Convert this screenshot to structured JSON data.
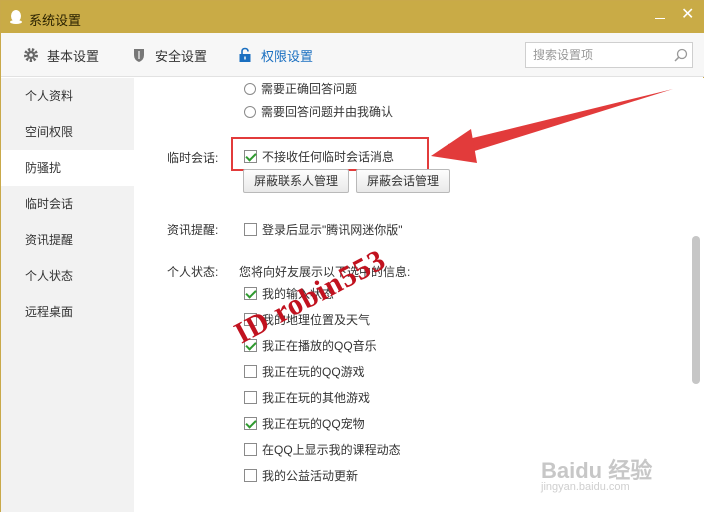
{
  "window": {
    "title": "系统设置"
  },
  "toolbar": {
    "tabs": [
      {
        "label": "基本设置",
        "icon": "gear-icon"
      },
      {
        "label": "安全设置",
        "icon": "shield-icon"
      },
      {
        "label": "权限设置",
        "icon": "lock-icon",
        "active": true
      }
    ],
    "search_placeholder": "搜索设置项"
  },
  "sidebar": {
    "items": [
      {
        "label": "个人资料"
      },
      {
        "label": "空间权限"
      },
      {
        "label": "防骚扰",
        "active": true
      },
      {
        "label": "临时会话"
      },
      {
        "label": "资讯提醒"
      },
      {
        "label": "个人状态"
      },
      {
        "label": "远程桌面"
      }
    ]
  },
  "content": {
    "verify_options": [
      {
        "label": "需要正确回答问题",
        "selected": false
      },
      {
        "label": "需要回答问题并由我确认",
        "selected": false
      }
    ],
    "temp_session": {
      "section_label": "临时会话:",
      "checkbox_label": "不接收任何临时会话消息",
      "checked": true,
      "buttons": [
        "屏蔽联系人管理",
        "屏蔽会话管理"
      ]
    },
    "news": {
      "section_label": "资讯提醒:",
      "checkbox_label": "登录后显示\"腾讯网迷你版\"",
      "checked": false
    },
    "status": {
      "section_label": "个人状态:",
      "intro": "您将向好友展示以下选中的信息:",
      "items": [
        {
          "label": "我的输入状态",
          "checked": true
        },
        {
          "label": "我的地理位置及天气",
          "checked": false
        },
        {
          "label": "我正在播放的QQ音乐",
          "checked": true
        },
        {
          "label": "我正在玩的QQ游戏",
          "checked": false
        },
        {
          "label": "我正在玩的其他游戏",
          "checked": false
        },
        {
          "label": "我正在玩的QQ宠物",
          "checked": true
        },
        {
          "label": "在QQ上显示我的课程动态",
          "checked": false
        },
        {
          "label": "我的公益活动更新",
          "checked": false
        }
      ]
    }
  },
  "watermark": {
    "text": "ID robin553"
  },
  "baidu_watermark": {
    "brand": "Baidu 经验",
    "url": "jingyan.baidu.com"
  },
  "colors": {
    "titlebar": "#c9ab46",
    "accent_tab": "#1a6fc0",
    "checkmark": "#2f9a2f",
    "annotation_red": "#e23b3b"
  }
}
